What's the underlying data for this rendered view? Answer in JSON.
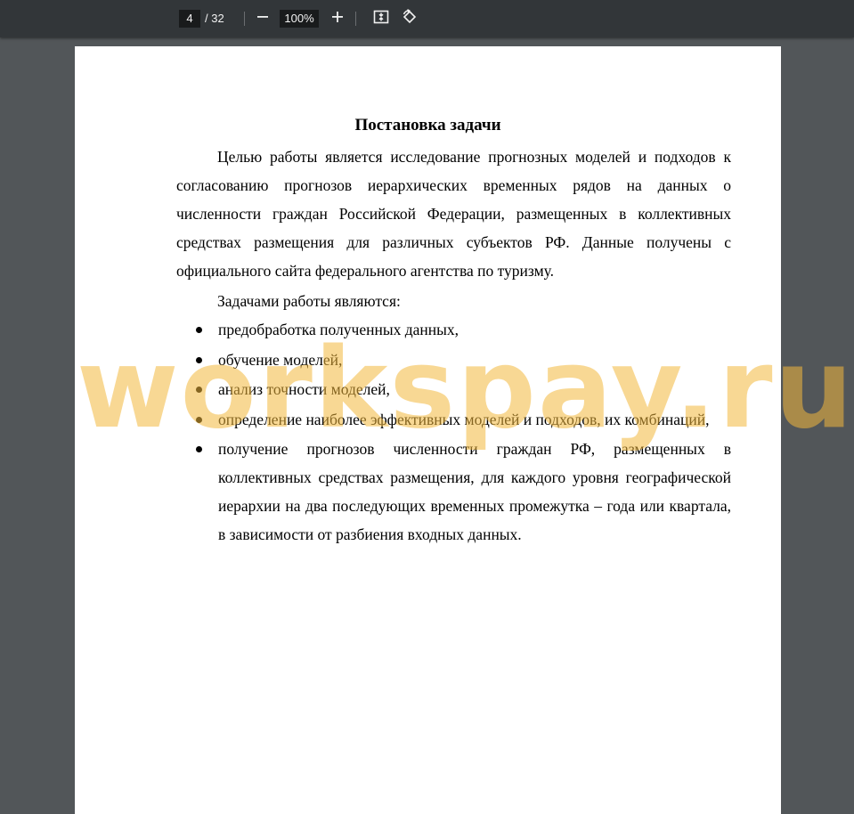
{
  "toolbar": {
    "page_current": "4",
    "page_total": "/ 32",
    "zoom_out_icon": "minus-icon",
    "zoom_value": "100%",
    "zoom_in_icon": "plus-icon",
    "fit_icon": "fit-page-icon",
    "rotate_icon": "rotate-icon"
  },
  "document": {
    "heading": "Постановка задачи",
    "paragraph1": "Целью работы является исследование прогнозных моделей и подходов к согласованию прогнозов иерархических временных рядов на данных о численности граждан Российской Федерации, размещенных в коллективных средствах размещения для различных субъектов РФ. Данные получены с официального сайта федерального агентства по туризму.",
    "paragraph2": "Задачами работы являются:",
    "tasks": [
      "предобработка полученных данных,",
      "обучение моделей,",
      "анализ точности моделей,",
      "определение наиболее эффективных моделей и подходов, их комбинаций,",
      "получение прогнозов численности граждан РФ, размещенных в коллективных средствах размещения, для каждого уровня географической иерархии на два последующих временных промежутка – года или квартала, в зависимости от разбиения входных данных."
    ]
  },
  "watermark": {
    "text": "workspay.ru",
    "color": "#f2b83c"
  },
  "colors": {
    "toolbar_bg": "#323639",
    "viewer_bg": "#525659",
    "page_bg": "#ffffff"
  }
}
